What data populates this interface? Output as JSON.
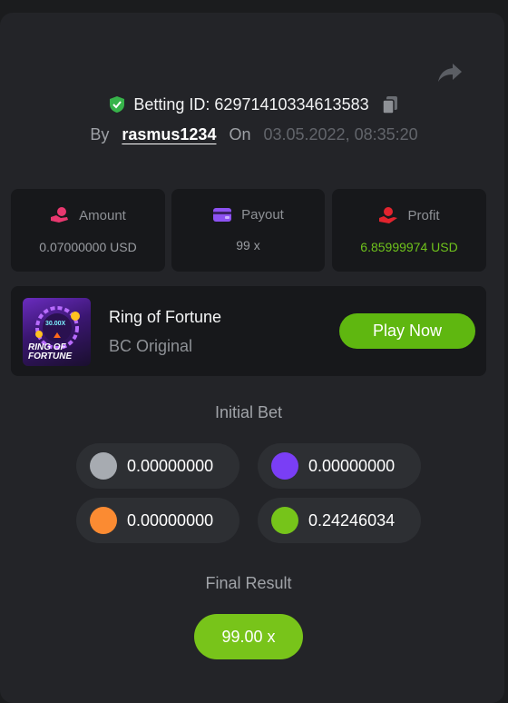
{
  "bet": {
    "id_label": "Betting ID: 62971410334613583",
    "by_label": "By",
    "username": "rasmus1234",
    "on_label": "On",
    "datetime": "03.05.2022, 08:35:20"
  },
  "stats": [
    {
      "label": "Amount",
      "value": "0.07000000 USD",
      "icon": "coins-hand-icon",
      "color": "#e8386f"
    },
    {
      "label": "Payout",
      "value": "99 x",
      "icon": "wallet-card-icon",
      "color": "#8d52f2"
    },
    {
      "label": "Profit",
      "value": "6.85999974 USD",
      "icon": "hand-coin-icon",
      "color": "#e2242e"
    }
  ],
  "game": {
    "title": "Ring of Fortune",
    "subtitle": "BC Original",
    "thumb_multiplier": "30.00X",
    "thumb_line1": "RING OF",
    "thumb_line2": "FORTUNE",
    "play_label": "Play Now"
  },
  "initial_bet": {
    "title": "Initial Bet",
    "chips": [
      {
        "color": "#a7abb1",
        "amount": "0.00000000"
      },
      {
        "color": "#7a3ef5",
        "amount": "0.00000000"
      },
      {
        "color": "#fb8b32",
        "amount": "0.00000000"
      },
      {
        "color": "#76c41a",
        "amount": "0.24246034"
      }
    ]
  },
  "final_result": {
    "title": "Final Result",
    "value": "99.00 x"
  },
  "colors": {
    "accent_green": "#5fb710",
    "panel": "#232428",
    "card": "#17181b"
  }
}
